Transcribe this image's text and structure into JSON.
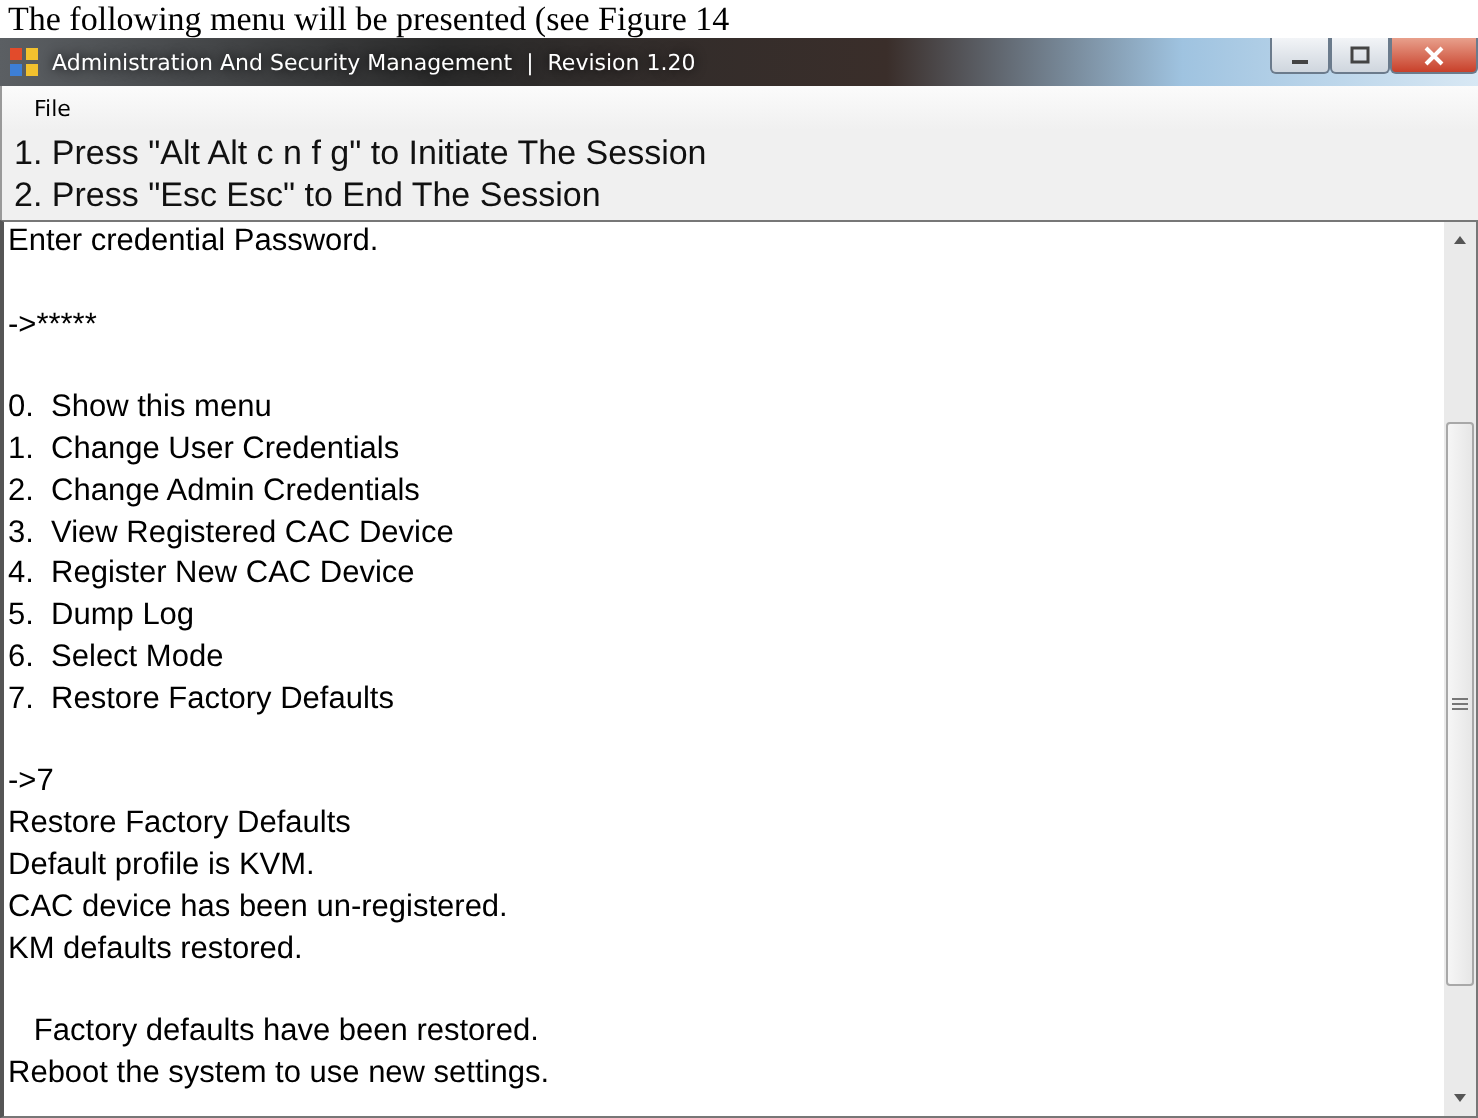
{
  "document_line": "The following menu will be presented (see Figure 14",
  "window": {
    "title": "Administration And Security Management  |  Revision 1.20"
  },
  "menu": [
    "File"
  ],
  "instructions": [
    "1. Press \"Alt Alt c n f g\" to Initiate The Session",
    "2. Press \"Esc Esc\" to End The Session"
  ],
  "console": [
    {
      "kind": "text",
      "text": "Enter credential Password."
    },
    {
      "kind": "blank"
    },
    {
      "kind": "text",
      "text": "->*****"
    },
    {
      "kind": "blank"
    },
    {
      "kind": "text",
      "text": "0.  Show this menu"
    },
    {
      "kind": "text",
      "text": "1.  Change User Credentials"
    },
    {
      "kind": "text",
      "text": "2.  Change Admin Credentials"
    },
    {
      "kind": "text",
      "text": "3.  View Registered CAC Device"
    },
    {
      "kind": "text",
      "text": "4.  Register New CAC Device"
    },
    {
      "kind": "text",
      "text": "5.  Dump Log"
    },
    {
      "kind": "text",
      "text": "6.  Select Mode"
    },
    {
      "kind": "text",
      "text": "7.  Restore Factory Defaults"
    },
    {
      "kind": "blank"
    },
    {
      "kind": "text",
      "text": "->7"
    },
    {
      "kind": "text",
      "text": "Restore Factory Defaults"
    },
    {
      "kind": "text",
      "text": "Default profile is KVM."
    },
    {
      "kind": "text",
      "text": "CAC device has been un-registered."
    },
    {
      "kind": "text",
      "text": "KM defaults restored."
    },
    {
      "kind": "blank"
    },
    {
      "kind": "text",
      "text": "   Factory defaults have been restored."
    },
    {
      "kind": "text",
      "text": "Reboot the system to use new settings."
    }
  ]
}
